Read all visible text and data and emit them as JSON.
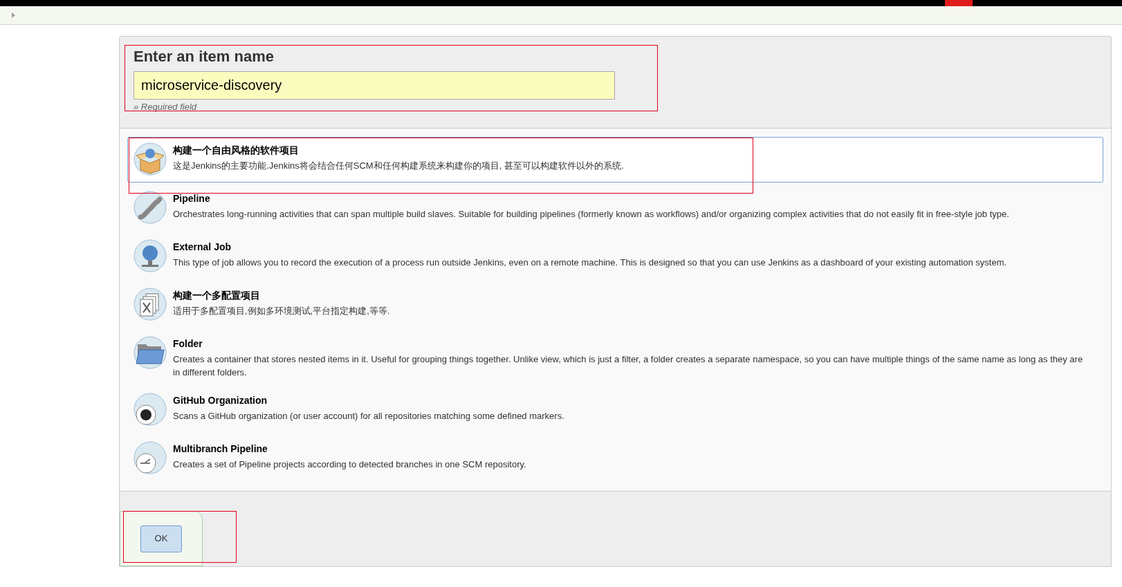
{
  "name_section": {
    "title": "Enter an item name",
    "value": "microservice-discovery",
    "hint": "» Required field"
  },
  "items": [
    {
      "kind": "freestyle",
      "title": "构建一个自由风格的软件项目",
      "description": "这是Jenkins的主要功能.Jenkins将会结合任何SCM和任何构建系统来构建你的项目, 甚至可以构建软件以外的系统.",
      "selected": true
    },
    {
      "kind": "pipeline",
      "title": "Pipeline",
      "description": "Orchestrates long-running activities that can span multiple build slaves. Suitable for building pipelines (formerly known as workflows) and/or organizing complex activities that do not easily fit in free-style job type.",
      "selected": false
    },
    {
      "kind": "external",
      "title": "External Job",
      "description": "This type of job allows you to record the execution of a process run outside Jenkins, even on a remote machine. This is designed so that you can use Jenkins as a dashboard of your existing automation system.",
      "selected": false
    },
    {
      "kind": "matrix",
      "title": "构建一个多配置项目",
      "description": "适用于多配置项目,例如多环境测试,平台指定构建,等等.",
      "selected": false
    },
    {
      "kind": "folder",
      "title": "Folder",
      "description": "Creates a container that stores nested items in it. Useful for grouping things together. Unlike view, which is just a filter, a folder creates a separate namespace, so you can have multiple things of the same name as long as they are in different folders.",
      "selected": false
    },
    {
      "kind": "github",
      "title": "GitHub Organization",
      "description": "Scans a GitHub organization (or user account) for all repositories matching some defined markers.",
      "selected": false
    },
    {
      "kind": "multibranch",
      "title": "Multibranch Pipeline",
      "description": "Creates a set of Pipeline projects according to detected branches in one SCM repository.",
      "selected": false
    }
  ],
  "ok_button": "OK"
}
